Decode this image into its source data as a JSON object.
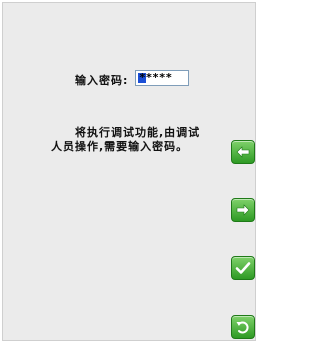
{
  "password_prompt": {
    "label": "输入密码:",
    "masked_value": "*****"
  },
  "message": {
    "line1": "将执行调试功能,由调试",
    "line2": "人员操作,需要输入密码。"
  },
  "side_buttons": {
    "accent_color": "#3aa72c",
    "icons": [
      "back-arrow-icon",
      "forward-arrow-icon",
      "checkmark-icon",
      "return-icon"
    ]
  }
}
